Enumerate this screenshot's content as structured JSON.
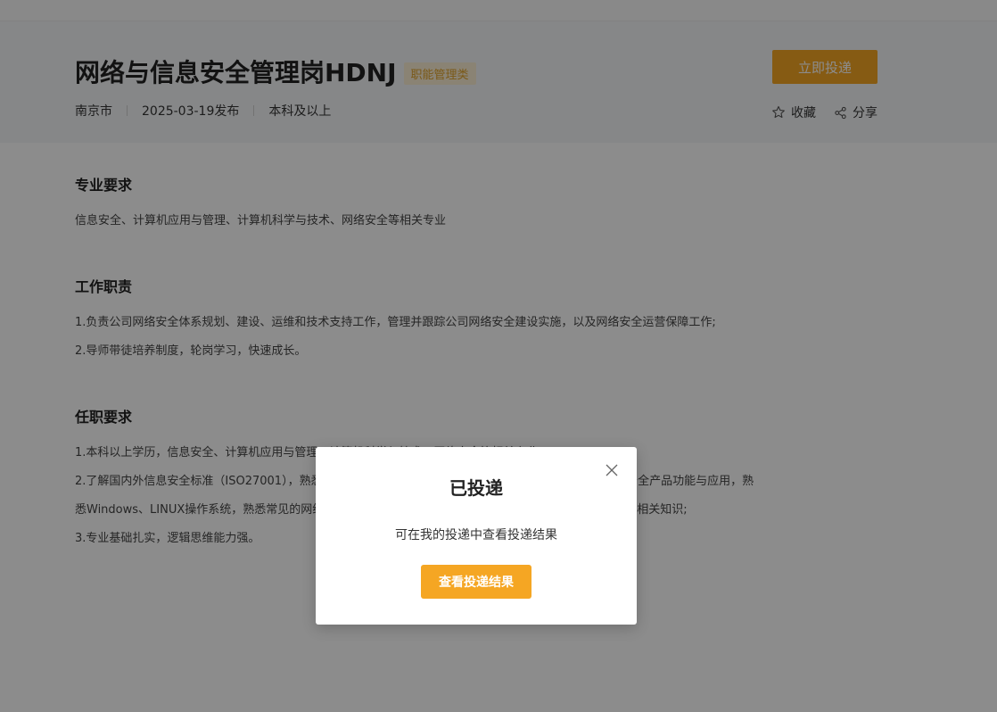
{
  "job": {
    "title": "网络与信息安全管理岗HDNJ",
    "tag": "职能管理类",
    "location": "南京市",
    "published": "2025-03-19发布",
    "education": "本科及以上",
    "apply_label": "立即投递",
    "favorite_label": "收藏",
    "share_label": "分享"
  },
  "sections": [
    {
      "title": "专业要求",
      "lines": [
        "信息安全、计算机应用与管理、计算机科学与技术、网络安全等相关专业"
      ]
    },
    {
      "title": "工作职责",
      "lines": [
        "1.负责公司网络安全体系规划、建设、运维和技术支持工作，管理并跟踪公司网络安全建设实施，以及网络安全运营保障工作;",
        "2.导师带徒培养制度，轮岗学习，快速成长。"
      ]
    },
    {
      "title": "任职要求",
      "lines": [
        "1.本科以上学历，信息安全、计算机应用与管理、计算机科学与技术、网络安全等相关专业;",
        "2.了解国内外信息安全标准（ISO27001），熟悉常见网络安全设备的配置与管理，了解防火墙、WAF等网络安全产品功能与应用，熟",
        "悉Windows、LINUX操作系统，熟悉常见的网络攻击手段与防护方法，了解网络安全法律法规，熟悉数据安全相关知识;",
        "3.专业基础扎实，逻辑思维能力强。"
      ]
    }
  ],
  "modal": {
    "title": "已投递",
    "message": "可在我的投递中查看投递结果",
    "button_label": "查看投递结果"
  },
  "colors": {
    "accent": "#f5a623",
    "tag_text": "#e0a32a",
    "tag_bg": "#fbeed3"
  }
}
